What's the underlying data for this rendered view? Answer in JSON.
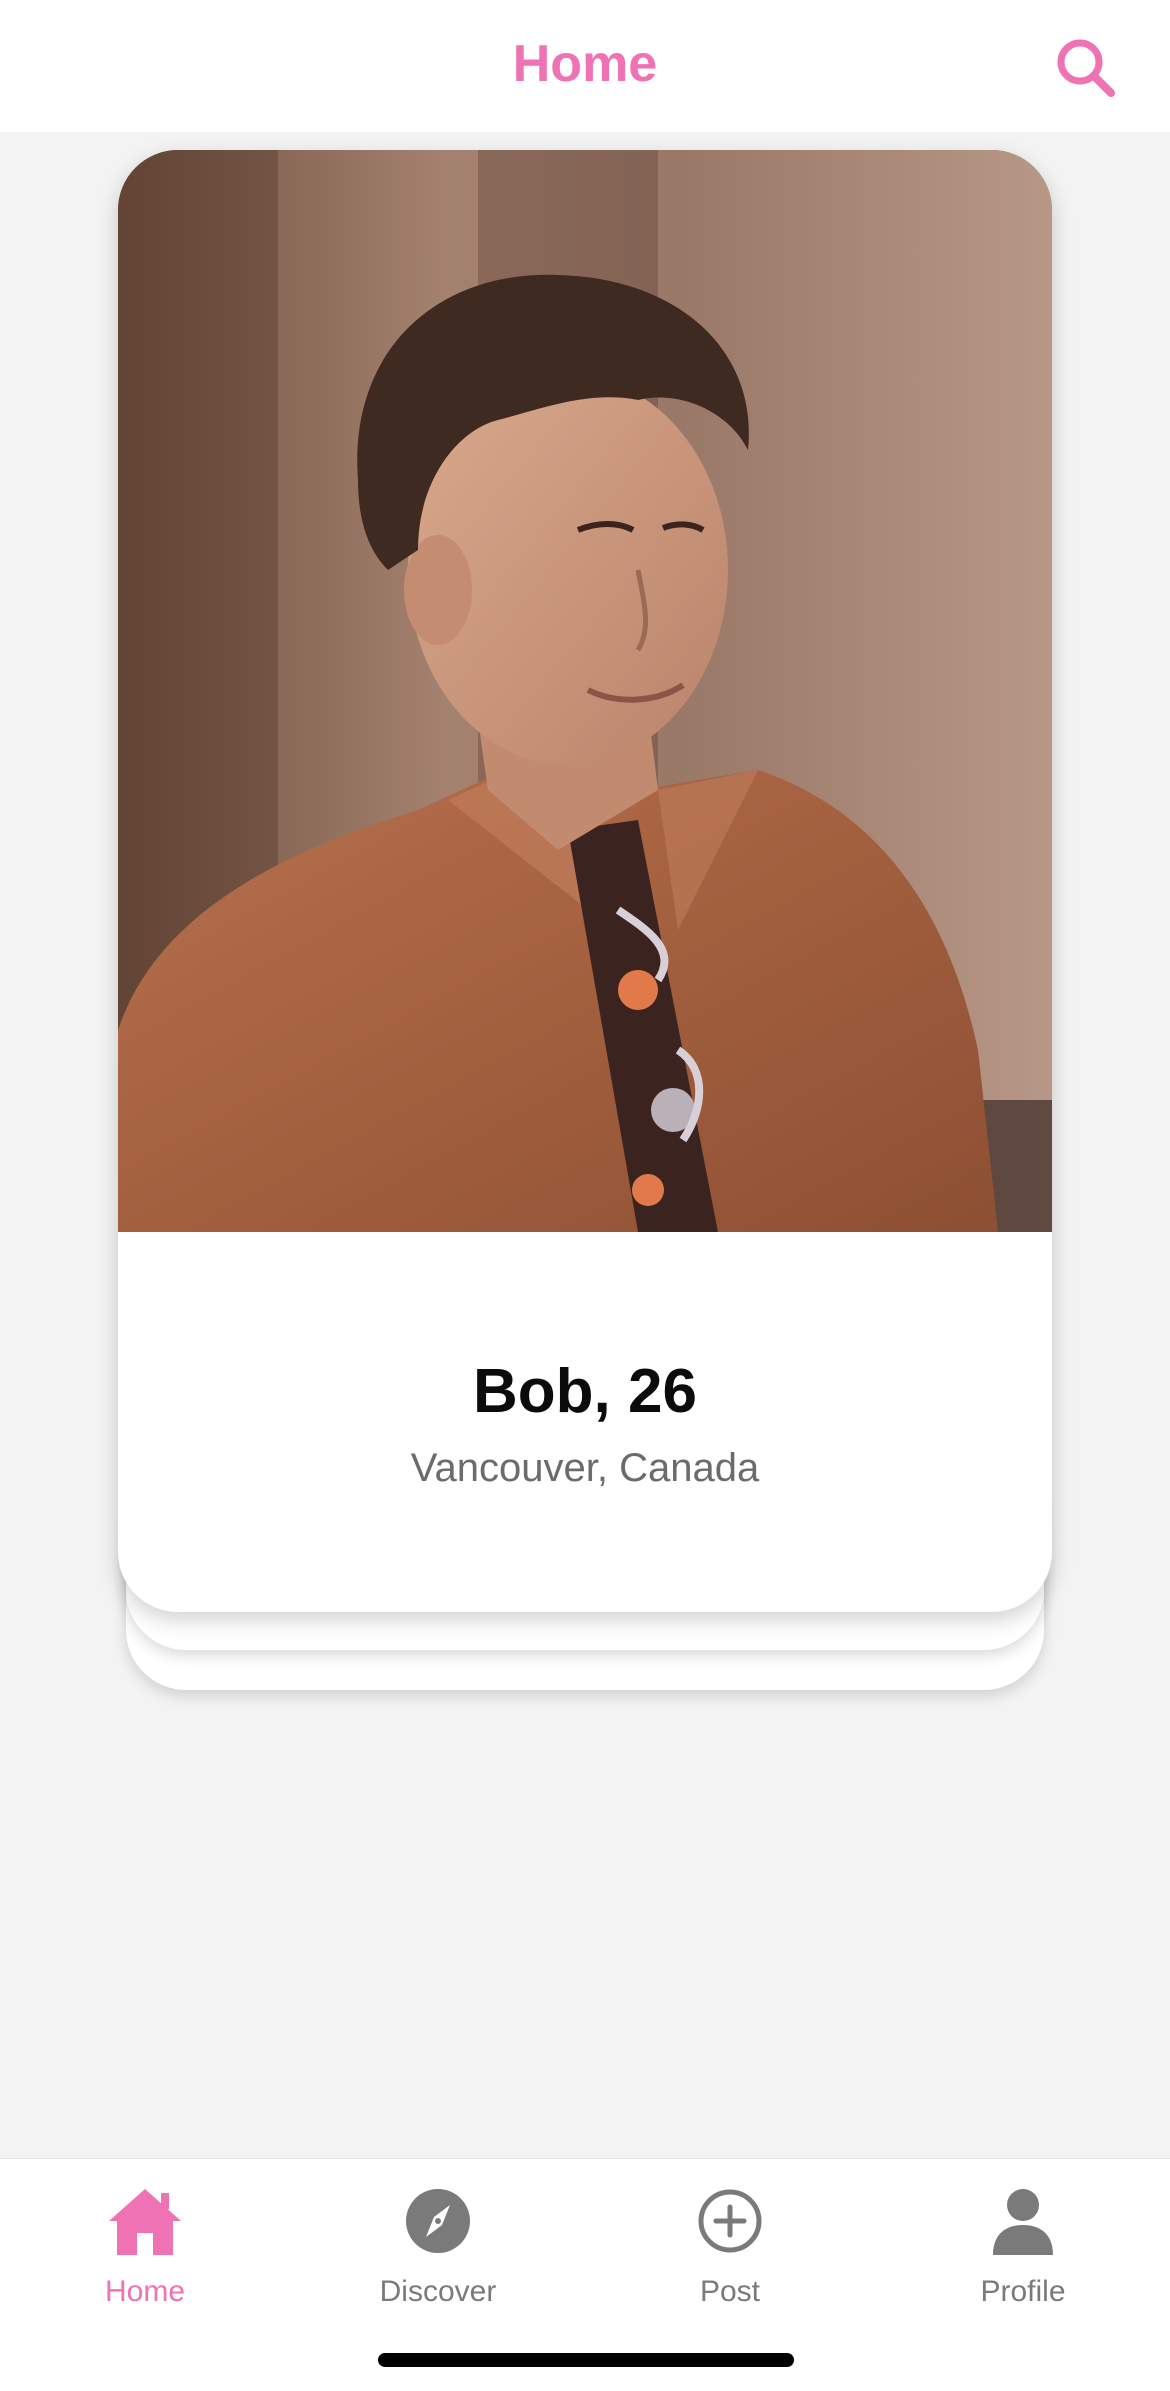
{
  "header": {
    "title": "Home",
    "search_icon": "search-icon"
  },
  "profile_card": {
    "name_age": "Bob, 26",
    "location": "Vancouver, Canada",
    "photo": "profile-photo"
  },
  "tab_bar": {
    "tabs": [
      {
        "label": "Home",
        "icon": "home-icon",
        "active": true
      },
      {
        "label": "Discover",
        "icon": "compass-icon",
        "active": false
      },
      {
        "label": "Post",
        "icon": "plus-circle-icon",
        "active": false
      },
      {
        "label": "Profile",
        "icon": "person-icon",
        "active": false
      }
    ]
  },
  "colors": {
    "accent": "#ee72b4",
    "inactive": "#7a7a7a",
    "background": "#f3f3f3",
    "card": "#ffffff"
  }
}
